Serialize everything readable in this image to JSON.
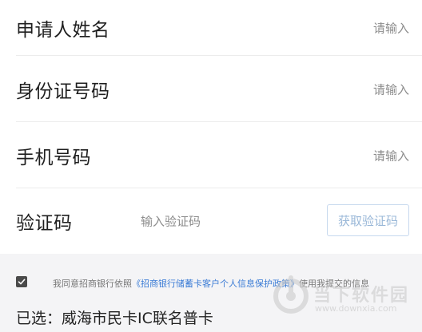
{
  "form": {
    "applicant_name": {
      "label": "申请人姓名",
      "placeholder": "请输入"
    },
    "id_number": {
      "label": "身份证号码",
      "placeholder": "请输入"
    },
    "phone": {
      "label": "手机号码",
      "placeholder": "请输入"
    },
    "verification": {
      "label": "验证码",
      "placeholder": "输入验证码",
      "button_label": "获取验证码"
    }
  },
  "agreement": {
    "checked": true,
    "prefix": "我同意招商银行依照",
    "policy_link": "《招商银行储蓄卡客户个人信息保护政策》",
    "suffix": "使用我提交的信息"
  },
  "selection": {
    "text": "已选：威海市民卡IC联名普卡"
  },
  "watermark": {
    "name": "当下软件园",
    "url": "www.downxia.com"
  },
  "colors": {
    "link": "#3a7bd5",
    "code_button_border": "#c6d8ee",
    "code_button_text": "#9ab8d8",
    "placeholder": "#8c8c8c",
    "background": "#f4f4f6"
  },
  "icons": {
    "checkbox": "checkmark-icon",
    "watermark_logo": "downxia-logo-icon"
  }
}
